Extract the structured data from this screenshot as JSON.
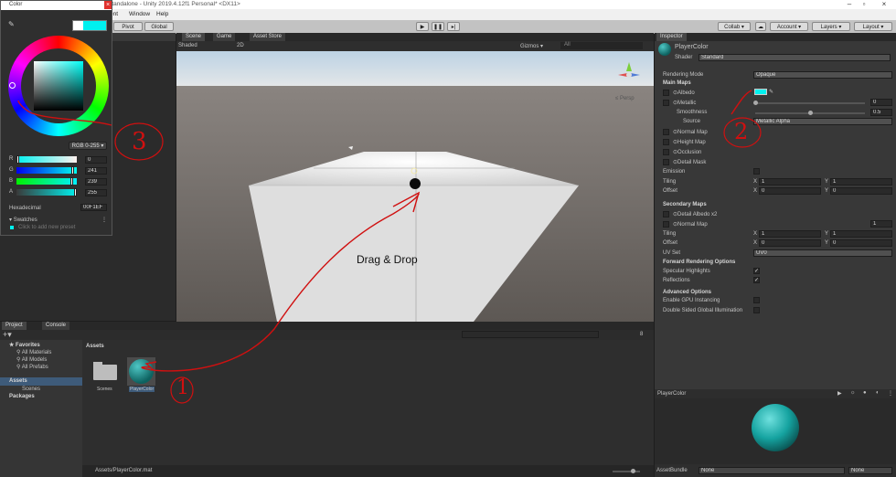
{
  "window": {
    "title": "Standalone - Unity 2019.4.12f1 Personal* <DX11>"
  },
  "menu": [
    "ent",
    "Window",
    "Help"
  ],
  "toolbar": {
    "pivot": "Pivot",
    "global": "Global",
    "collab": "Collab ▾",
    "account": "Account ▾",
    "layers": "Layers ▾",
    "layout": "Layout ▾"
  },
  "scene": {
    "tabs": [
      "Scene",
      "Game",
      "Asset Store"
    ],
    "shading": "Shaded",
    "mode2d": "2D",
    "gizmos": "Gizmos ▾",
    "search_placeholder": "All",
    "persp": "≤ Persp",
    "annotation": "Drag & Drop"
  },
  "color_picker": {
    "title": "Color",
    "mode": "RGB 0-255 ▾",
    "channels": [
      {
        "label": "R",
        "value": "0",
        "fill": 0.0
      },
      {
        "label": "G",
        "value": "241",
        "fill": 0.945
      },
      {
        "label": "B",
        "value": "239",
        "fill": 0.937
      },
      {
        "label": "A",
        "value": "255",
        "fill": 1.0
      }
    ],
    "hex_label": "Hexadecimal",
    "hex_value": "00F1EF",
    "swatches_label": "Swatches",
    "swatches_hint": "Click to add new preset",
    "current_color": "#00f1ef"
  },
  "project": {
    "tabs": [
      "Project",
      "Console"
    ],
    "favorites": "Favorites",
    "fav_items": [
      "All Materials",
      "All Models",
      "All Prefabs"
    ],
    "assets": "Assets",
    "scenes": "Scenes",
    "packages": "Packages",
    "breadcrumb": "Assets",
    "items": [
      {
        "label": "Scenes"
      },
      {
        "label": "PlayerColor"
      }
    ],
    "status_path": "Assets/PlayerColor.mat",
    "hidden_count": "8"
  },
  "inspector": {
    "tab": "Inspector",
    "material_name": "PlayerColor",
    "shader_label": "Shader",
    "shader_value": "Standard",
    "rendering_mode_label": "Rendering Mode",
    "rendering_mode_value": "Opaque",
    "main_maps": "Main Maps",
    "albedo": "Albedo",
    "metallic": "Metallic",
    "metallic_value": "0",
    "smoothness": "Smoothness",
    "smoothness_value": "0.5",
    "source": "Source",
    "source_value": "Metallic Alpha",
    "normal_map": "Normal Map",
    "height_map": "Height Map",
    "occlusion": "Occlusion",
    "detail_mask": "Detail Mask",
    "emission": "Emission",
    "tiling": "Tiling",
    "offset": "Offset",
    "tiling_x": "1",
    "tiling_y": "1",
    "offset_x": "0",
    "offset_y": "0",
    "axis_x": "X",
    "axis_y": "Y",
    "secondary_maps": "Secondary Maps",
    "detail_albedo": "Detail Albedo x2",
    "normal_map2": "Normal Map",
    "normal_map2_value": "1",
    "tiling2_x": "1",
    "tiling2_y": "1",
    "offset2_x": "0",
    "offset2_y": "0",
    "uv_set": "UV Set",
    "uv_set_value": "UV0",
    "forward_opts": "Forward Rendering Options",
    "specular": "Specular Highlights",
    "reflections": "Reflections",
    "advanced": "Advanced Options",
    "gpu_instancing": "Enable GPU Instancing",
    "double_sided_gi": "Double Sided Global Illumination",
    "preview_title": "PlayerColor",
    "assetbundle_label": "AssetBundle",
    "assetbundle_value": "None",
    "variant_value": "None"
  },
  "annotations": {
    "step1": "1",
    "step2": "2",
    "step3": "3"
  }
}
